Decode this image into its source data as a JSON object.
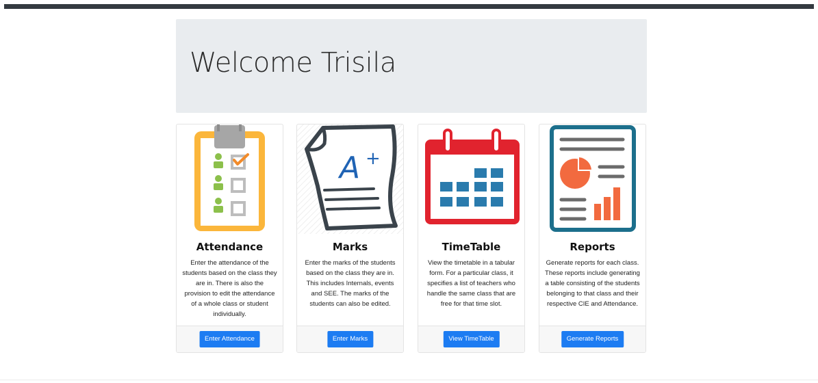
{
  "header": {
    "welcome": "Welcome Trisila"
  },
  "cards": [
    {
      "icon": "attendance-clipboard-icon",
      "title": "Attendance",
      "text": "Enter the attendance of the students based on the class they are in. There is also the provision to edit the attendance of a whole class or student individually.",
      "button": "Enter Attendance"
    },
    {
      "icon": "marks-paper-icon",
      "title": "Marks",
      "text": "Enter the marks of the students based on the class they are in. This includes Internals, events and SEE. The marks of the students can also be edited.",
      "button": "Enter Marks"
    },
    {
      "icon": "calendar-icon",
      "title": "TimeTable",
      "text": "View the timetable in a tabular form. For a particular class, it specifies a list of teachers who handle the same class that are free for that time slot.",
      "button": "View TimeTable"
    },
    {
      "icon": "report-icon",
      "title": "Reports",
      "text": "Generate reports for each class. These reports include generating a table consisting of the students belonging to that class and their respective CIE and Attendance.",
      "button": "Generate Reports"
    }
  ],
  "colors": {
    "navbar": "#343a40",
    "jumbotron": "#e9ecef",
    "button": "#1d7cf2",
    "clipboard": "#fbb63b",
    "calendar": "#e1232e",
    "calendar_cells": "#2a7bad",
    "report_frame": "#1c6f8c",
    "report_chart": "#f26a3f"
  }
}
